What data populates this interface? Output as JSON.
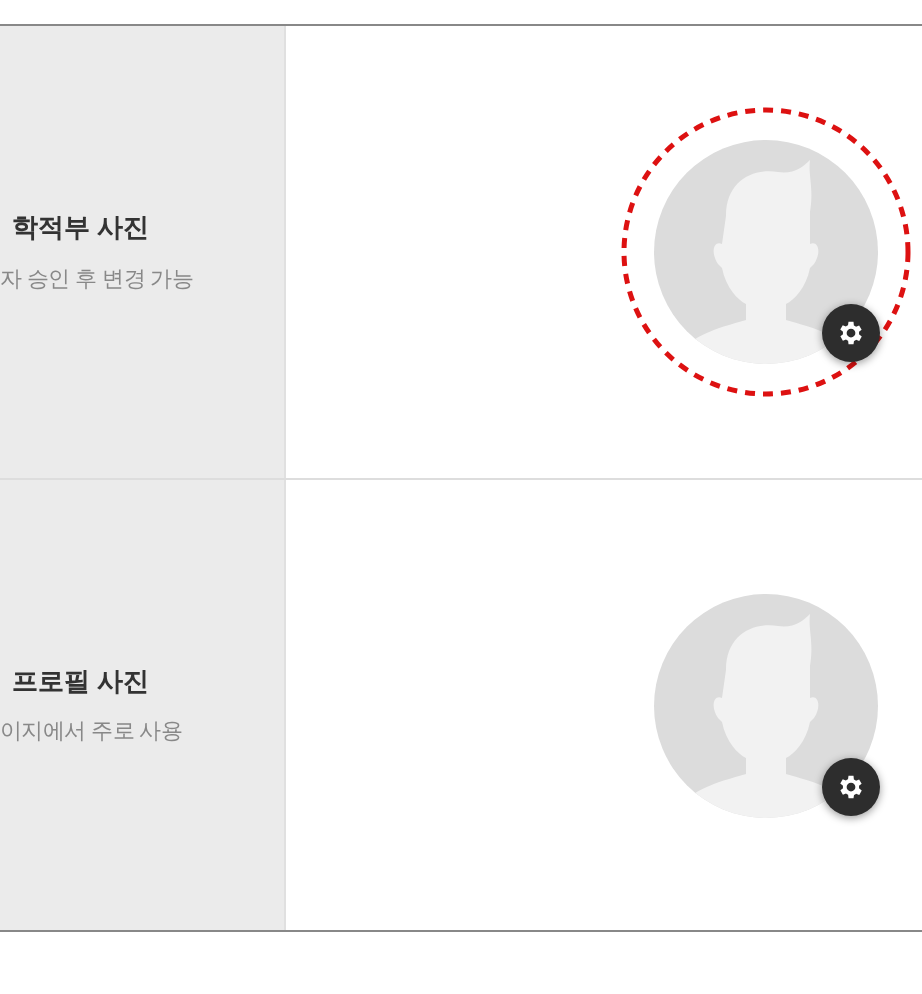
{
  "rows": [
    {
      "title": "학적부 사진",
      "description": "자 승인 후 변경 가능",
      "highlighted": true
    },
    {
      "title": "프로필 사진",
      "description": "이지에서 주로 사용",
      "highlighted": false
    }
  ]
}
